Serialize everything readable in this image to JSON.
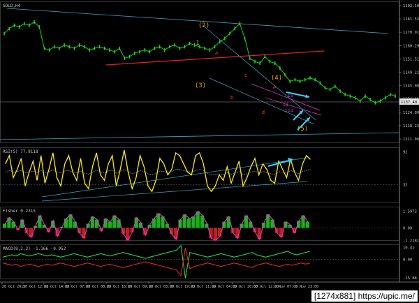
{
  "colors": {
    "background": "#000000",
    "price": "#19e619",
    "ma_red": "#e6231e",
    "channel": "#3aa7c8",
    "label_orange": "#f6a500",
    "label_red": "#ff3a2b",
    "cyan_arrow": "#3ad0f2",
    "pink": "#e23bd6",
    "rsi": "#ffe81c",
    "rsi_avg": "#9a9a9a",
    "fisher_line": "#e23bd6",
    "fisher_hist": "#1fd01f",
    "macd_green": "#24d84a",
    "macd_red": "#e02424",
    "axis_text": "#c8c8c8"
  },
  "chart_data": [
    {
      "type": "line",
      "title": "GOLD,H4",
      "ylabel": "",
      "ylim": [
        1108.5,
        1194.5
      ],
      "price_box": "1137.40",
      "y_ticks": [
        "1192.10",
        "1181.53",
        "1170.91",
        "1160.29",
        "1151.51",
        "1149.22",
        "1145.98",
        "1134.61",
        "1124.09",
        "1118.23",
        "1111.06"
      ],
      "series": [
        {
          "values": [
            1175,
            1178,
            1180,
            1179,
            1181,
            1180,
            1182,
            1179,
            1166,
            1165,
            1167,
            1166,
            1168,
            1167,
            1166,
            1168,
            1167,
            1165,
            1166,
            1167,
            1166,
            1165,
            1164,
            1166,
            1160,
            1161,
            1163,
            1164,
            1165,
            1164,
            1166,
            1167,
            1165,
            1167,
            1168,
            1166,
            1167,
            1169,
            1168,
            1167,
            1166,
            1165,
            1167,
            1170,
            1172,
            1175,
            1178,
            1181,
            1172,
            1160,
            1158,
            1157,
            1161,
            1158,
            1157,
            1154,
            1150,
            1146,
            1147,
            1146,
            1147,
            1148,
            1147,
            1145,
            1142,
            1141,
            1143,
            1140,
            1138,
            1137,
            1136,
            1134,
            1137,
            1135,
            1133,
            1134,
            1136,
            1138,
            1137
          ]
        }
      ],
      "wave_labels": [
        {
          "text": "(2)",
          "color": "orange",
          "value": 1187
        },
        {
          "text": "1",
          "color": "orange",
          "value": 1176
        },
        {
          "text": "a",
          "color": "red",
          "value": 1168
        },
        {
          "text": "(3)",
          "color": "orange",
          "value": 1140
        },
        {
          "text": "b",
          "color": "red",
          "value": 1132
        },
        {
          "text": "c",
          "color": "red",
          "value": 1147
        },
        {
          "text": "(4)",
          "color": "orange",
          "value": 1148
        },
        {
          "text": "e",
          "color": "red",
          "value": 1140
        },
        {
          "text": "d",
          "color": "red",
          "value": 1126
        },
        {
          "text": "iv",
          "color": "pink",
          "value": 1135
        },
        {
          "text": "ii",
          "color": "pink",
          "value": 1130
        },
        {
          "text": "iii",
          "color": "pink",
          "value": 1124
        },
        {
          "text": "(5)",
          "color": "orange",
          "value": 1117
        }
      ]
    },
    {
      "type": "line",
      "title": "RSI(5) 77.9118",
      "ylim": [
        0,
        100
      ],
      "y_ticks": [
        "92",
        "32"
      ],
      "level": 32,
      "series": [
        {
          "values": [
            70,
            85,
            45,
            60,
            80,
            30,
            55,
            75,
            40,
            85,
            35,
            60,
            90,
            45,
            30,
            70,
            85,
            55,
            40,
            80,
            35,
            25,
            65,
            90,
            50,
            40,
            70,
            85,
            30,
            60,
            95,
            55,
            25,
            45,
            85,
            65,
            30,
            20,
            40,
            80,
            70,
            50,
            60,
            90,
            85,
            70,
            55,
            50,
            85,
            90,
            70,
            30,
            20,
            30,
            50,
            40,
            65,
            35,
            55,
            75,
            30,
            45,
            65,
            80,
            50,
            70,
            60,
            40,
            35,
            75,
            60,
            45,
            78,
            55,
            40,
            70,
            85,
            78
          ],
          "avg": [
            55,
            58,
            55,
            56,
            58,
            54,
            55,
            57,
            55,
            58,
            54,
            56,
            59,
            55,
            54,
            57,
            58,
            55,
            54,
            57,
            53,
            51,
            55,
            59,
            55,
            53,
            57,
            59,
            53,
            56,
            60,
            56,
            52,
            54,
            58,
            56,
            52,
            50,
            53,
            57,
            56,
            54,
            56,
            60,
            60,
            58,
            56,
            55,
            58,
            60,
            58,
            53,
            50,
            50,
            52,
            51,
            54,
            51,
            53,
            56,
            51,
            52,
            55,
            57,
            53,
            56,
            55,
            52,
            51,
            56,
            55,
            53,
            58,
            55,
            52,
            56,
            58,
            60
          ]
        }
      ]
    },
    {
      "type": "bar",
      "title": "Fisher 0.2315",
      "ylim": [
        -1.25,
        2.05
      ],
      "y_ticks": [
        "1.5973",
        "0.00",
        "-1.2181"
      ],
      "values": [
        0.4,
        1.0,
        0.6,
        -0.2,
        0.8,
        -0.5,
        -0.9,
        0.2,
        1.2,
        0.3,
        -0.4,
        0.7,
        -0.8,
        0.1,
        0.9,
        1.3,
        0.6,
        -0.5,
        -1.0,
        0.4,
        1.1,
        0.8,
        -0.3,
        0.9,
        0.6,
        1.2,
        0.8,
        -0.6,
        -1.2,
        -0.4,
        1.0,
        0.5,
        -0.7,
        0.3,
        0.9,
        1.4,
        1.1,
        0.4,
        -0.6,
        -1.1,
        0.8,
        1.3,
        0.9,
        1.1,
        1.6,
        1.2,
        0.4,
        -1.0,
        -1.2,
        -0.8,
        0.6,
        1.1,
        -0.5,
        -1.0,
        0.4,
        1.2,
        0.6,
        -0.4,
        -1.1,
        0.5,
        1.3,
        0.8,
        -0.5,
        -0.9,
        0.6,
        0.3,
        -0.5,
        0.7,
        1.2,
        0.6
      ]
    },
    {
      "type": "line",
      "title": "MACD(8,2,2) -1.166 -0.952",
      "ylim": [
        -17,
        13
      ],
      "y_ticks": [
        "10.41",
        "0.00",
        "-15.88"
      ],
      "series": [
        {
          "values": [
            2,
            3,
            4,
            3,
            5,
            4,
            3,
            4,
            5,
            4,
            3,
            4,
            3,
            2,
            3,
            4,
            5,
            4,
            3,
            2,
            3,
            4,
            5,
            4,
            3,
            4,
            5,
            6,
            5,
            4,
            3,
            2,
            1,
            2,
            3,
            4,
            5,
            6,
            7,
            8,
            12,
            -16,
            6,
            5,
            4,
            3,
            2,
            3,
            4,
            5,
            4,
            3,
            2,
            3,
            4,
            5,
            6,
            4,
            3,
            2,
            3,
            4,
            5,
            6,
            7,
            5,
            4,
            5,
            6,
            7
          ]
        },
        {
          "values": [
            -3,
            -4,
            -5,
            -4,
            -6,
            -5,
            -4,
            -5,
            -6,
            -5,
            -4,
            -5,
            -4,
            -3,
            -4,
            -5,
            -6,
            -5,
            -4,
            -3,
            -4,
            -5,
            -6,
            -5,
            -4,
            -5,
            -6,
            -7,
            -6,
            -5,
            -4,
            -3,
            -2,
            -3,
            -4,
            -5,
            -6,
            -7,
            -8,
            -9,
            -14,
            10,
            -8,
            -6,
            -5,
            -4,
            -3,
            -4,
            -5,
            -6,
            -5,
            -4,
            -3,
            -4,
            -5,
            -6,
            -7,
            -5,
            -4,
            -3,
            -4,
            -5,
            -6,
            -5,
            -4,
            -5,
            -4,
            -3,
            -4,
            -3
          ]
        }
      ]
    }
  ],
  "time_axis": [
    "20 Oct 2015",
    "20 Oct 12:00",
    "21 Oct 14:00",
    "22 Oct 07:00",
    "23 Oct 00:00",
    "23 Oct 16:00",
    "26 Oct 09:00",
    "27 Oct 03:00",
    "27 Oct 19:00",
    "28 Oct 11:00",
    "29 Oct 04:00",
    "29 Oct 20:00",
    "30 Oct 12:00",
    "2 Nov 07:00",
    "2 Nov 23:00"
  ],
  "watermark": "[1274x881] https://upic.me/"
}
